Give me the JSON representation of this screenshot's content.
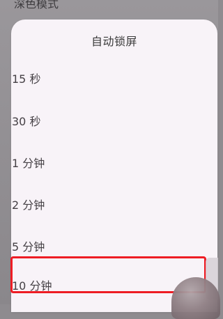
{
  "background": {
    "title": "深色模式"
  },
  "sheet": {
    "title": "自动锁屏",
    "options": [
      {
        "label": "15 秒"
      },
      {
        "label": "30 秒"
      },
      {
        "label": "1 分钟"
      },
      {
        "label": "2 分钟"
      },
      {
        "label": "5 分钟"
      },
      {
        "label": "10 分钟"
      }
    ]
  },
  "colors": {
    "highlight_border": "#ee1c24",
    "sheet_background": "#f8f3f8",
    "backdrop": "#8e8b8f"
  },
  "icons": {
    "finger": "finger-overlay"
  }
}
